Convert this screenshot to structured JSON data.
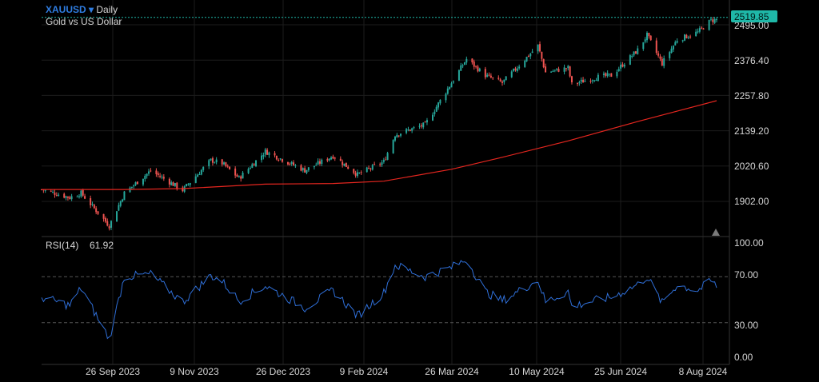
{
  "header": {
    "symbol": "XAUUSD",
    "dropdown_glyph": "▾",
    "timeframe": "Daily",
    "description": "Gold vs US Dollar"
  },
  "price_axis": {
    "ticks": [
      "2495.00",
      "2376.40",
      "2257.80",
      "2139.20",
      "2020.60",
      "1902.00"
    ],
    "current_price": "2519.85"
  },
  "rsi_panel": {
    "label": "RSI(14)",
    "value": "61.92",
    "ticks": [
      "100.00",
      "70.00",
      "30.00",
      "0.00"
    ]
  },
  "time_axis": {
    "ticks": [
      "26 Sep 2023",
      "9 Nov 2023",
      "26 Dec 2023",
      "9 Feb 2024",
      "26 Mar 2024",
      "10 May 2024",
      "25 Jun 2024",
      "8 Aug 2024"
    ]
  },
  "colors": {
    "background": "#000000",
    "up_candle": "#26a69a",
    "down_candle": "#ef5350",
    "moving_average": "#e5261f",
    "rsi_line": "#2f6fd8",
    "current_price_label": "#1fb8a8",
    "grid": "#1c1c1c",
    "axis_text": "#d6d6d6"
  },
  "chart_data": [
    {
      "type": "candlestick",
      "title": "XAUUSD Daily",
      "subtitle": "Gold vs US Dollar",
      "xlabel": "",
      "ylabel": "",
      "x_ticks": [
        "26 Sep 2023",
        "9 Nov 2023",
        "26 Dec 2023",
        "9 Feb 2024",
        "26 Mar 2024",
        "10 May 2024",
        "25 Jun 2024",
        "8 Aug 2024"
      ],
      "ylim": [
        1830,
        2540
      ],
      "y_ticks": [
        1902.0,
        2020.6,
        2139.2,
        2257.8,
        2376.4,
        2495.0
      ],
      "last_price": 2519.85,
      "close_keypoints": [
        {
          "date": "2023-08-30",
          "close": 1942
        },
        {
          "date": "2023-09-14",
          "close": 1915
        },
        {
          "date": "2023-09-20",
          "close": 1930
        },
        {
          "date": "2023-10-05",
          "close": 1820
        },
        {
          "date": "2023-10-13",
          "close": 1930
        },
        {
          "date": "2023-10-27",
          "close": 2005
        },
        {
          "date": "2023-11-13",
          "close": 1940
        },
        {
          "date": "2023-11-28",
          "close": 2040
        },
        {
          "date": "2023-12-04",
          "close": 2030
        },
        {
          "date": "2023-12-13",
          "close": 1980
        },
        {
          "date": "2023-12-27",
          "close": 2070
        },
        {
          "date": "2024-01-17",
          "close": 2006
        },
        {
          "date": "2024-02-01",
          "close": 2055
        },
        {
          "date": "2024-02-14",
          "close": 1992
        },
        {
          "date": "2024-02-28",
          "close": 2035
        },
        {
          "date": "2024-03-05",
          "close": 2126
        },
        {
          "date": "2024-03-21",
          "close": 2160
        },
        {
          "date": "2024-04-04",
          "close": 2300
        },
        {
          "date": "2024-04-12",
          "close": 2380
        },
        {
          "date": "2024-04-22",
          "close": 2325
        },
        {
          "date": "2024-05-01",
          "close": 2300
        },
        {
          "date": "2024-05-20",
          "close": 2425
        },
        {
          "date": "2024-05-24",
          "close": 2335
        },
        {
          "date": "2024-06-05",
          "close": 2350
        },
        {
          "date": "2024-06-07",
          "close": 2295
        },
        {
          "date": "2024-06-21",
          "close": 2320
        },
        {
          "date": "2024-06-28",
          "close": 2325
        },
        {
          "date": "2024-07-12",
          "close": 2410
        },
        {
          "date": "2024-07-17",
          "close": 2460
        },
        {
          "date": "2024-07-25",
          "close": 2365
        },
        {
          "date": "2024-08-02",
          "close": 2445
        },
        {
          "date": "2024-08-13",
          "close": 2470
        },
        {
          "date": "2024-08-20",
          "close": 2510
        },
        {
          "date": "2024-08-23",
          "close": 2512
        }
      ],
      "moving_average": [
        {
          "date": "2023-08-30",
          "value": 1942
        },
        {
          "date": "2023-10-13",
          "value": 1942
        },
        {
          "date": "2023-11-13",
          "value": 1945
        },
        {
          "date": "2023-12-27",
          "value": 1960
        },
        {
          "date": "2024-02-01",
          "value": 1962
        },
        {
          "date": "2024-02-28",
          "value": 1970
        },
        {
          "date": "2024-04-04",
          "value": 2010
        },
        {
          "date": "2024-05-01",
          "value": 2050
        },
        {
          "date": "2024-06-05",
          "value": 2105
        },
        {
          "date": "2024-07-12",
          "value": 2170
        },
        {
          "date": "2024-08-02",
          "value": 2205
        },
        {
          "date": "2024-08-23",
          "value": 2240
        }
      ]
    },
    {
      "type": "line",
      "title": "RSI(14)",
      "xlabel": "",
      "ylabel": "",
      "ylim": [
        0,
        100
      ],
      "y_ticks": [
        0,
        30,
        70,
        100
      ],
      "reference_lines": [
        30,
        70
      ],
      "last_value": 61.92,
      "series": [
        {
          "name": "RSI(14)",
          "points": [
            {
              "date": "2023-08-30",
              "value": 52
            },
            {
              "date": "2023-09-14",
              "value": 45
            },
            {
              "date": "2023-09-20",
              "value": 60
            },
            {
              "date": "2023-10-05",
              "value": 16
            },
            {
              "date": "2023-10-13",
              "value": 70
            },
            {
              "date": "2023-10-27",
              "value": 72
            },
            {
              "date": "2023-11-13",
              "value": 48
            },
            {
              "date": "2023-11-28",
              "value": 71
            },
            {
              "date": "2023-12-04",
              "value": 66
            },
            {
              "date": "2023-12-13",
              "value": 49
            },
            {
              "date": "2023-12-27",
              "value": 62
            },
            {
              "date": "2024-01-17",
              "value": 43
            },
            {
              "date": "2024-02-01",
              "value": 58
            },
            {
              "date": "2024-02-14",
              "value": 36
            },
            {
              "date": "2024-02-28",
              "value": 56
            },
            {
              "date": "2024-03-05",
              "value": 80
            },
            {
              "date": "2024-03-21",
              "value": 70
            },
            {
              "date": "2024-04-04",
              "value": 78
            },
            {
              "date": "2024-04-12",
              "value": 85
            },
            {
              "date": "2024-04-22",
              "value": 57
            },
            {
              "date": "2024-05-01",
              "value": 49
            },
            {
              "date": "2024-05-20",
              "value": 67
            },
            {
              "date": "2024-05-24",
              "value": 48
            },
            {
              "date": "2024-06-05",
              "value": 57
            },
            {
              "date": "2024-06-07",
              "value": 44
            },
            {
              "date": "2024-06-21",
              "value": 50
            },
            {
              "date": "2024-06-28",
              "value": 52
            },
            {
              "date": "2024-07-12",
              "value": 63
            },
            {
              "date": "2024-07-17",
              "value": 70
            },
            {
              "date": "2024-07-25",
              "value": 47
            },
            {
              "date": "2024-08-02",
              "value": 63
            },
            {
              "date": "2024-08-13",
              "value": 58
            },
            {
              "date": "2024-08-20",
              "value": 66
            },
            {
              "date": "2024-08-23",
              "value": 61.92
            }
          ]
        }
      ]
    }
  ]
}
